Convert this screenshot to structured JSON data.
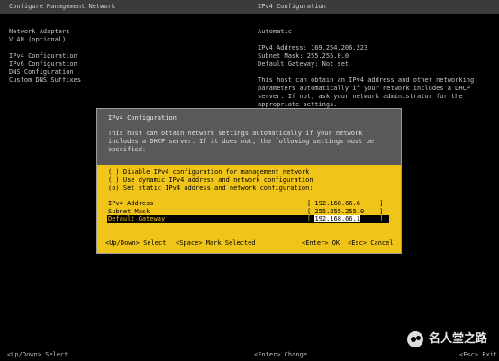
{
  "topbar": {
    "left_title": "Configure Management Network",
    "right_title": "IPv4 Configuration"
  },
  "left_menu": {
    "items": [
      "Network Adapters",
      "VLAN (optional)",
      "",
      "IPv4 Configuration",
      "IPv6 Configuration",
      "DNS Configuration",
      "Custom DNS Suffixes"
    ]
  },
  "right_pane": {
    "mode": "Automatic",
    "ipv4_address": "IPv4 Address: 169.254.206.223",
    "subnet_mask": "Subnet Mask: 255.255.0.0",
    "default_gateway": "Default Gateway: Not set",
    "help": "This host can obtain an IPv4 address and other networking parameters automatically if your network includes a DHCP server. If not, ask your network administrator for the appropriate settings."
  },
  "dialog": {
    "title": "IPv4 Configuration",
    "description": "This host can obtain network settings automatically if your network includes a DHCP server. If it does not, the following settings must be specified:",
    "options": [
      "( ) Disable IPv4 configuration for management network",
      "( ) Use dynamic IPv4 address and network configuration",
      "(o) Set static IPv4 address and network configuration:"
    ],
    "fields": {
      "ipv4_label": "IPv4 Address",
      "ipv4_value": "[ 192.168.66.6     ]",
      "subnet_label": "Subnet Mask",
      "subnet_value": "[ 255.255.255.0    ]",
      "gateway_label": "Default Gateway",
      "gateway_open": "[ ",
      "gateway_value": "192.168.66.1",
      "gateway_close": "     ]"
    },
    "hints": {
      "select": "<Up/Down> Select",
      "mark": "<Space> Mark Selected",
      "ok": "<Enter> OK",
      "cancel": "<Esc> Cancel"
    }
  },
  "bottombar": {
    "left": "<Up/Down> Select",
    "right_enter": "<Enter> Change",
    "right_esc": "<Esc> Exit"
  },
  "watermark": {
    "text": "名人堂之路",
    "icon": "wechat-icon"
  },
  "colors": {
    "background": "#000000",
    "dialog_bg": "#595959",
    "selection_yellow": "#f0c419",
    "topbar_bg": "#3b3b3b"
  }
}
